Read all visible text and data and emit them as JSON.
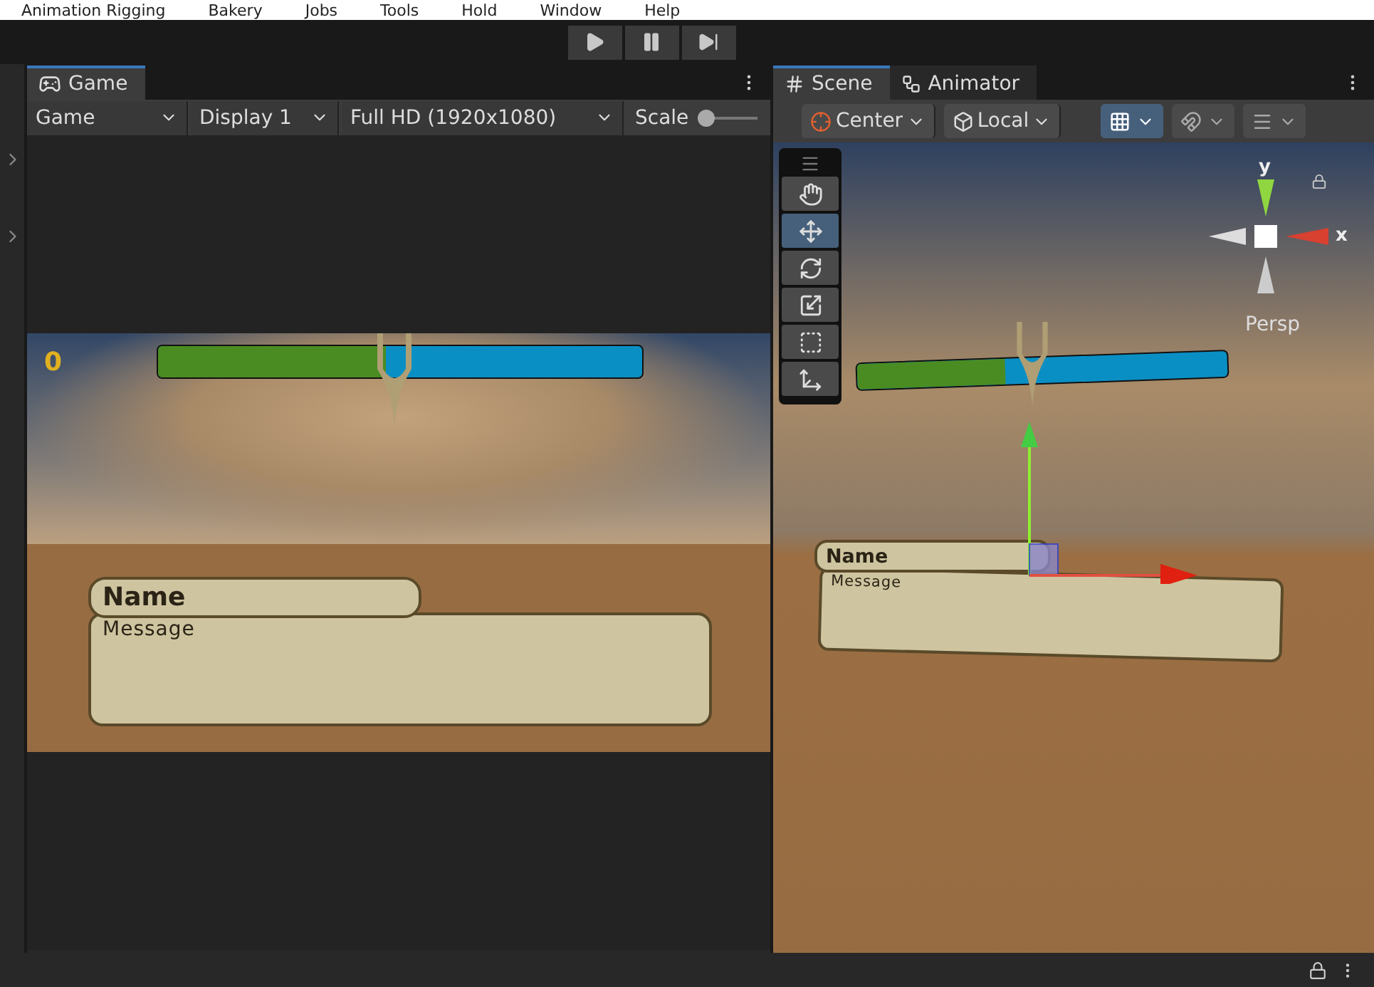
{
  "menu_bar": {
    "items": [
      "Animation Rigging",
      "Bakery",
      "Jobs",
      "Tools",
      "Hold",
      "Window",
      "Help"
    ]
  },
  "play_controls": [
    {
      "kind": "play"
    },
    {
      "kind": "pause"
    },
    {
      "kind": "step"
    }
  ],
  "game_panel": {
    "tab": "Game",
    "toolbar": {
      "view_dropdown": "Game",
      "display_dropdown": "Display 1",
      "resolution_dropdown": "Full HD (1920x1080)",
      "scale": {
        "label": "Scale",
        "level": 0
      }
    },
    "view": {
      "score": "0",
      "health_bar": {
        "level": 0.47
      },
      "dialog": {
        "name": "Name",
        "message": "Message"
      }
    }
  },
  "scene_panel": {
    "tabs": [
      {
        "label": "Scene",
        "selected": true,
        "kind": "scene"
      },
      {
        "label": "Animator",
        "selected": false,
        "kind": "animator"
      }
    ],
    "toolbar": {
      "pivot_dropdown": "Center",
      "space_dropdown": "Local",
      "toggles": [
        {
          "kind": "grid",
          "on": true
        },
        {
          "kind": "snap",
          "on": false
        },
        {
          "kind": "increment",
          "on": false
        }
      ]
    },
    "tools": [
      {
        "kind": "hand",
        "selected": false
      },
      {
        "kind": "move",
        "selected": true
      },
      {
        "kind": "rotate",
        "selected": false
      },
      {
        "kind": "scale",
        "selected": false
      },
      {
        "kind": "rect",
        "selected": false
      },
      {
        "kind": "transform",
        "selected": false
      }
    ],
    "gizmo": {
      "y_label": "y",
      "x_label": "x",
      "projection": "Persp"
    },
    "view": {
      "health_bar": {
        "level": 0.4
      },
      "dialog": {
        "name": "Name",
        "message": "Message"
      }
    }
  }
}
